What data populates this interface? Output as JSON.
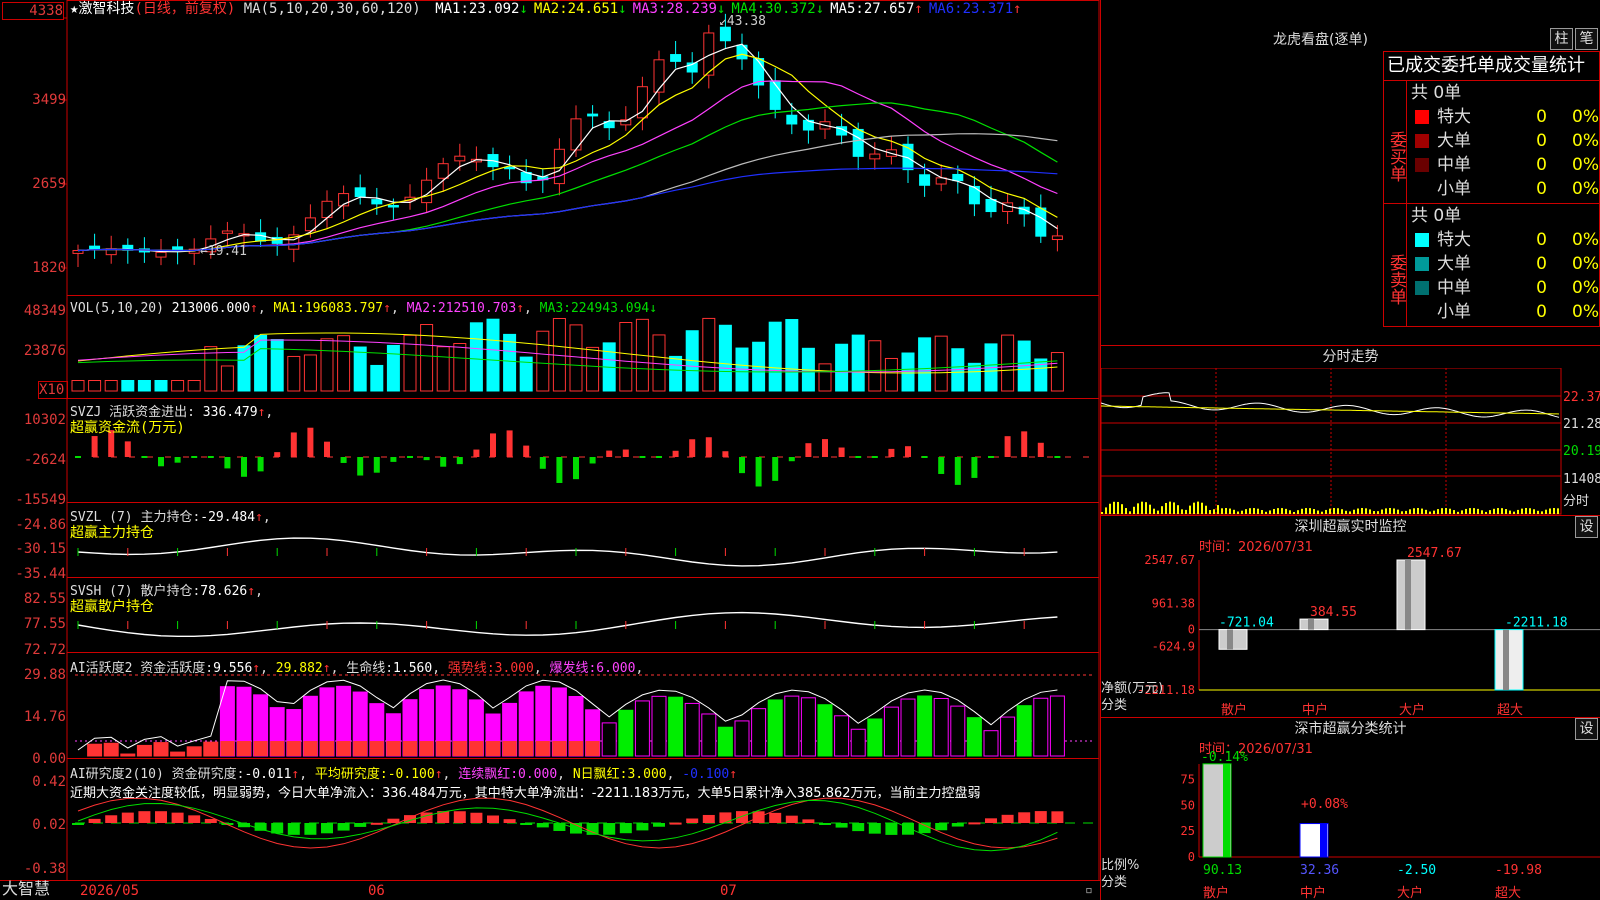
{
  "stock": {
    "name": "激智科技",
    "period": "(日线，前复权)",
    "ma_params": "MA(5,10,20,30,60,120)"
  },
  "ma_values": [
    {
      "label": "MA1:",
      "value": "23.092",
      "arrow": "↓",
      "color": "#ffffff"
    },
    {
      "label": "MA2:",
      "value": "24.651",
      "arrow": "↓",
      "color": "#ffff00"
    },
    {
      "label": "MA3:",
      "value": "28.239",
      "arrow": "↓",
      "color": "#ff40ff"
    },
    {
      "label": "MA4:",
      "value": "30.372",
      "arrow": "↓",
      "color": "#00e000"
    },
    {
      "label": "MA5:",
      "value": "27.657",
      "arrow": "↑",
      "color": "#ffffff"
    },
    {
      "label": "MA6:",
      "value": "23.371",
      "arrow": "↑",
      "color": "#2030ff"
    }
  ],
  "price_axis": [
    "4338",
    "3499",
    "2659",
    "1820"
  ],
  "price_markers": {
    "high": "43.38",
    "low": "19.41"
  },
  "vol": {
    "title": "VOL(5,10,20)",
    "value": "213006.000",
    "ma1": "196083.797",
    "ma2": "212510.703",
    "ma3": "224943.094",
    "axis": [
      "48349",
      "23876"
    ],
    "unit": "X10"
  },
  "svzj": {
    "title": "SVZJ  活跃资金进出:",
    "value": "336.479",
    "sub": "超赢资金流(万元)",
    "axis": [
      "10302",
      "-2624",
      "-15549"
    ]
  },
  "svzl": {
    "title": "SVZL (7) 主力持仓:",
    "value": "-29.484",
    "sub": "超赢主力持仓",
    "axis": [
      "-24.86",
      "-30.15",
      "-35.44"
    ]
  },
  "svsh": {
    "title": "SVSH (7) 散户持仓:",
    "value": "78.626",
    "sub": "超赢散户持仓",
    "axis": [
      "82.55",
      "77.55",
      "72.72"
    ]
  },
  "ai1": {
    "title": "AI活跃度2 资金活跃度:",
    "v1": "9.556",
    "v2": "29.882",
    "life_label": "生命线:",
    "life": "1.560",
    "strong_label": "强势线:",
    "strong": "3.000",
    "burst_label": "爆发线:",
    "burst": "6.000",
    "axis": [
      "29.88",
      "14.76",
      "0.00"
    ]
  },
  "ai2": {
    "title": "AI研究度2(10) 资金研究度:",
    "v1": "-0.011",
    "avg_label": "平均研究度:",
    "avg": "-0.100",
    "c1_label": "连续飘红:",
    "c1": "0.000",
    "c2_label": "N日飘红:",
    "c2": "3.000",
    "c3": "-0.100",
    "axis": [
      "0.42",
      "0.02",
      "-0.38"
    ],
    "note": "近期大资金关注度较低，明显弱势，今日大单净流入：336.484万元，其中特大单净流出：-2211.183万元，大单5日累计净入385.862万元，当前主力控盘弱"
  },
  "date_axis": {
    "logo": "大智慧",
    "d1": "2026/05",
    "d2": "06",
    "d3": "07"
  },
  "lhb": {
    "title": "龙虎看盘(逐单)",
    "btn1": "柱",
    "btn2": "笔",
    "header": "已成交委托单成交量统计",
    "buy": {
      "side_label": "委买单",
      "total": "共 0单",
      "rows": [
        {
          "label": "特大",
          "n": "0",
          "p": "0%",
          "color": "#ff0000"
        },
        {
          "label": "大单",
          "n": "0",
          "p": "0%",
          "color": "#a00000"
        },
        {
          "label": "中单",
          "n": "0",
          "p": "0%",
          "color": "#6a0000"
        },
        {
          "label": "小单",
          "n": "0",
          "p": "0%",
          "color": "#000000"
        }
      ]
    },
    "sell": {
      "side_label": "委卖单",
      "total": "共 0单",
      "rows": [
        {
          "label": "特大",
          "n": "0",
          "p": "0%",
          "color": "#00ffff"
        },
        {
          "label": "大单",
          "n": "0",
          "p": "0%",
          "color": "#009a9a"
        },
        {
          "label": "中单",
          "n": "0",
          "p": "0%",
          "color": "#007070"
        },
        {
          "label": "小单",
          "n": "0",
          "p": "0%",
          "color": "#000000"
        }
      ]
    }
  },
  "intraday": {
    "title": "分时走势",
    "axis": [
      "22.37",
      "21.28",
      "20.19"
    ],
    "vol_label": "11408",
    "vol_unit": "分时"
  },
  "monitor": {
    "title": "深圳超赢实时监控",
    "set": "设",
    "time": "时间：2026/07/31",
    "unit": "净额(万元)",
    "cat_label": "分类",
    "axis": [
      "2547.67",
      "961.38",
      "0",
      "-624.9",
      "-2211.18"
    ],
    "chart_data": {
      "type": "bar",
      "categories": [
        "散户",
        "中户",
        "大户",
        "超大"
      ],
      "values": [
        -721.04,
        384.55,
        2547.67,
        -2211.18
      ],
      "ylabel": "净额(万元)",
      "ylim": [
        -2211.18,
        2547.67
      ]
    },
    "value_labels": [
      "-721.04",
      "384.55",
      "2547.67",
      "-2211.18"
    ]
  },
  "classify": {
    "title": "深市超赢分类统计",
    "set": "设",
    "time": "时间：2026/07/31",
    "unit": "比例%",
    "cat_label": "分类",
    "axis": [
      "75",
      "50",
      "25",
      "0"
    ],
    "top_labels": [
      "-0.14%",
      "+0.08%"
    ],
    "chart_data": {
      "type": "bar",
      "categories": [
        "散户",
        "中户",
        "大户",
        "超大"
      ],
      "values": [
        90.13,
        32.36,
        -2.5,
        -19.98
      ],
      "ylabel": "比例%",
      "ylim": [
        0,
        90
      ]
    },
    "value_labels": [
      "90.13",
      "32.36",
      "-2.50",
      "-19.98"
    ]
  }
}
